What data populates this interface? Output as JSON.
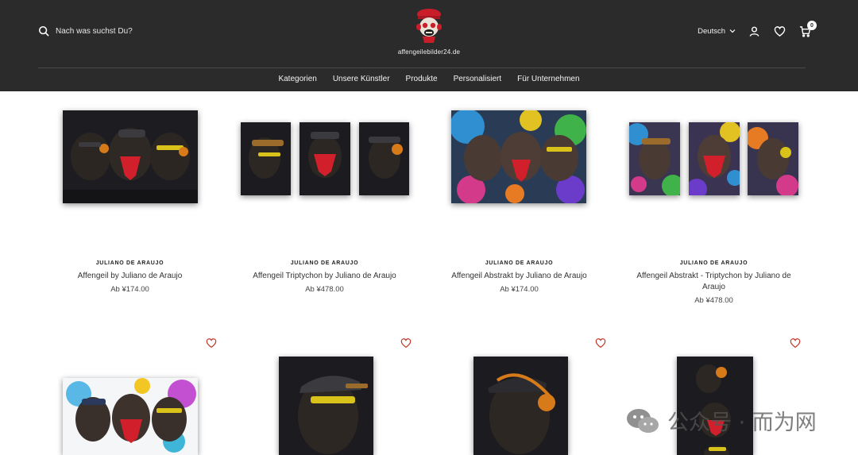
{
  "header": {
    "search_placeholder": "Nach was suchst Du?",
    "logo_text": "affengeilebilder24.de",
    "language": "Deutsch",
    "cart_count": "0",
    "icons": [
      "search-icon",
      "account-icon",
      "wishlist-heart-icon",
      "cart-icon",
      "chevron-down-icon"
    ]
  },
  "nav": {
    "items": [
      "Kategorien",
      "Unsere Künstler",
      "Produkte",
      "Personalisiert",
      "Für Unternehmen"
    ]
  },
  "products": [
    {
      "vendor": "JULIANO DE ARAUJO",
      "name": "Affengeil by Juliano de Araujo",
      "price": "Ab ¥174.00"
    },
    {
      "vendor": "JULIANO DE ARAUJO",
      "name": "Affengeil Triptychon by Juliano de Araujo",
      "price": "Ab ¥478.00"
    },
    {
      "vendor": "JULIANO DE ARAUJO",
      "name": "Affengeil Abstrakt by Juliano de Araujo",
      "price": "Ab ¥174.00"
    },
    {
      "vendor": "JULIANO DE ARAUJO",
      "name": "Affengeil Abstrakt - Triptychon by Juliano de Araujo",
      "price": "Ab ¥478.00"
    }
  ],
  "colors": {
    "header_bg": "#2b2b2b",
    "wishlist_heart": "#c0392b",
    "mask_red": "#d11f2b"
  },
  "watermark": {
    "text": "公众号 · 而为网"
  }
}
